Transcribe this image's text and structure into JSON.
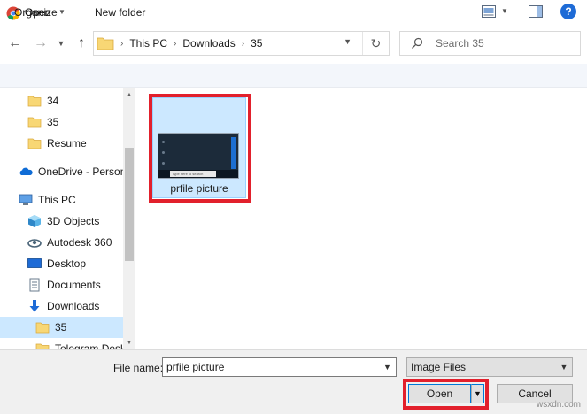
{
  "window": {
    "title": "Open"
  },
  "address": {
    "crumbs": [
      "This PC",
      "Downloads",
      "35"
    ]
  },
  "search": {
    "placeholder": "Search 35"
  },
  "toolbar": {
    "organize_label": "Organize",
    "new_folder_label": "New folder",
    "help_label": "?"
  },
  "sidebar": {
    "items": [
      {
        "label": "34",
        "icon": "folder-icon"
      },
      {
        "label": "35",
        "icon": "folder-icon"
      },
      {
        "label": "Resume",
        "icon": "folder-icon"
      },
      {
        "label": "OneDrive - Personal",
        "icon": "onedrive-icon"
      },
      {
        "label": "This PC",
        "icon": "computer-icon"
      },
      {
        "label": "3D Objects",
        "icon": "3d-objects-icon"
      },
      {
        "label": "Autodesk 360",
        "icon": "autodesk-icon"
      },
      {
        "label": "Desktop",
        "icon": "desktop-icon"
      },
      {
        "label": "Documents",
        "icon": "documents-icon"
      },
      {
        "label": "Downloads",
        "icon": "downloads-icon"
      },
      {
        "label": "35",
        "icon": "folder-icon",
        "selected": true
      },
      {
        "label": "Telegram Desktop",
        "icon": "folder-icon"
      }
    ]
  },
  "content": {
    "file": {
      "name": "prfile picture",
      "thumb_text": "Type here to search"
    }
  },
  "bottom": {
    "file_name_label": "File name:",
    "file_name_value": "prfile picture",
    "file_type_value": "Image Files",
    "open_label": "Open",
    "cancel_label": "Cancel"
  },
  "watermark": "wsxdn.com",
  "colors": {
    "accent": "#0078d7",
    "highlight": "#e2202c",
    "selection": "#cce8ff"
  }
}
